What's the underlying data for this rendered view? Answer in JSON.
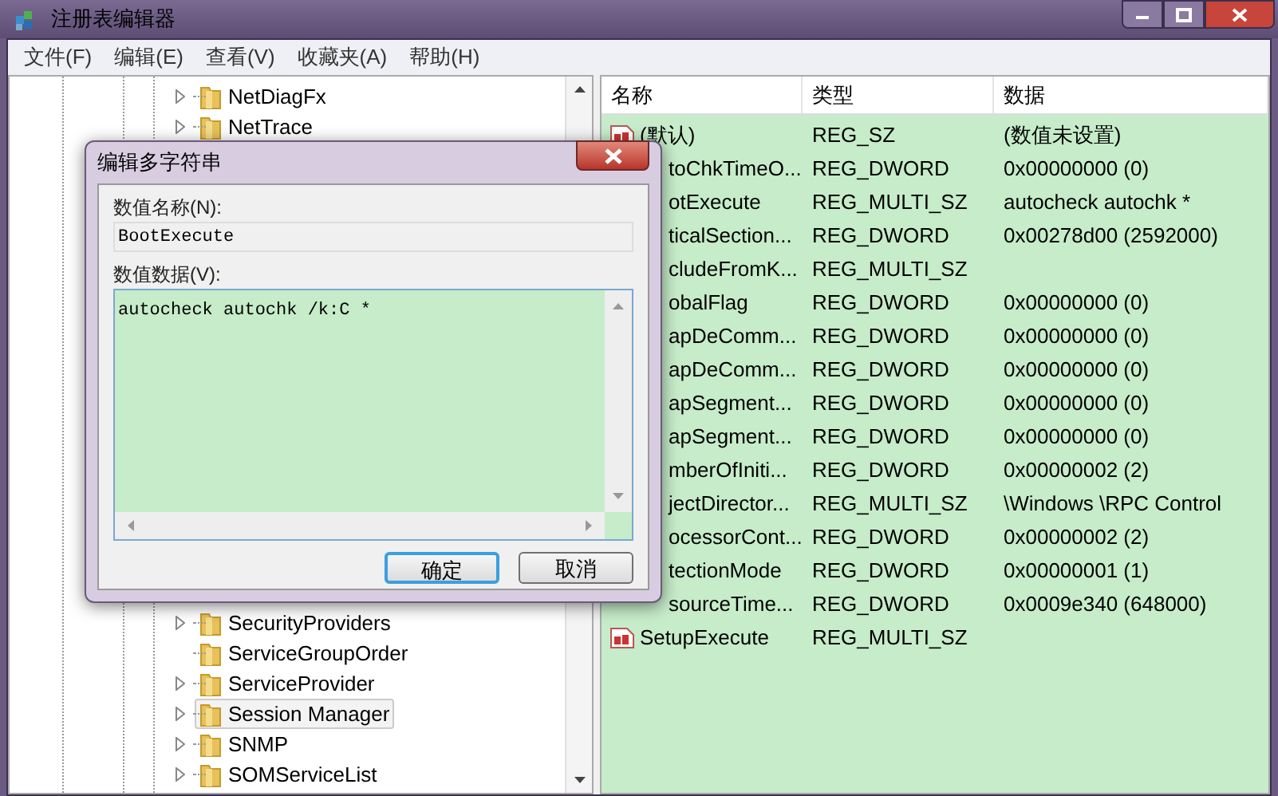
{
  "window": {
    "title": "注册表编辑器"
  },
  "menu": [
    "文件(F)",
    "编辑(E)",
    "查看(V)",
    "收藏夹(A)",
    "帮助(H)"
  ],
  "tree": [
    {
      "label": "NetDiagFx",
      "expandable": true,
      "selected": false
    },
    {
      "label": "NetTrace",
      "expandable": true,
      "selected": false
    }
  ],
  "tree_lower": [
    {
      "label": "SecurityProviders",
      "expandable": true,
      "selected": false
    },
    {
      "label": "ServiceGroupOrder",
      "expandable": false,
      "selected": false
    },
    {
      "label": "ServiceProvider",
      "expandable": true,
      "selected": false
    },
    {
      "label": "Session Manager",
      "expandable": true,
      "selected": true
    },
    {
      "label": "SNMP",
      "expandable": true,
      "selected": false
    },
    {
      "label": "SOMServiceList",
      "expandable": true,
      "selected": false
    }
  ],
  "list": {
    "columns": [
      "名称",
      "类型",
      "数据"
    ],
    "rows": [
      {
        "name": "(默认)",
        "type": "REG_SZ",
        "data": "(数值未设置)",
        "icon_visible": true
      },
      {
        "name": "toChkTimeO...",
        "type": "REG_DWORD",
        "data": "0x00000000 (0)",
        "icon_visible": false
      },
      {
        "name": "otExecute",
        "type": "REG_MULTI_SZ",
        "data": "autocheck autochk *",
        "icon_visible": false
      },
      {
        "name": "ticalSection...",
        "type": "REG_DWORD",
        "data": "0x00278d00 (2592000)",
        "icon_visible": false
      },
      {
        "name": "cludeFromK...",
        "type": "REG_MULTI_SZ",
        "data": "",
        "icon_visible": false
      },
      {
        "name": "obalFlag",
        "type": "REG_DWORD",
        "data": "0x00000000 (0)",
        "icon_visible": false
      },
      {
        "name": "apDeComm...",
        "type": "REG_DWORD",
        "data": "0x00000000 (0)",
        "icon_visible": false
      },
      {
        "name": "apDeComm...",
        "type": "REG_DWORD",
        "data": "0x00000000 (0)",
        "icon_visible": false
      },
      {
        "name": "apSegment...",
        "type": "REG_DWORD",
        "data": "0x00000000 (0)",
        "icon_visible": false
      },
      {
        "name": "apSegment...",
        "type": "REG_DWORD",
        "data": "0x00000000 (0)",
        "icon_visible": false
      },
      {
        "name": "mberOfIniti...",
        "type": "REG_DWORD",
        "data": "0x00000002 (2)",
        "icon_visible": false
      },
      {
        "name": "jectDirector...",
        "type": "REG_MULTI_SZ",
        "data": "\\Windows \\RPC Control",
        "icon_visible": false
      },
      {
        "name": "ocessorCont...",
        "type": "REG_DWORD",
        "data": "0x00000002 (2)",
        "icon_visible": false
      },
      {
        "name": "tectionMode",
        "type": "REG_DWORD",
        "data": "0x00000001 (1)",
        "icon_visible": false
      },
      {
        "name": "sourceTime...",
        "type": "REG_DWORD",
        "data": "0x0009e340 (648000)",
        "icon_visible": false
      },
      {
        "name": "SetupExecute",
        "type": "REG_MULTI_SZ",
        "data": "",
        "icon_visible": true
      }
    ]
  },
  "dialog": {
    "title": "编辑多字符串",
    "name_label": "数值名称(N):",
    "name_value": "BootExecute",
    "data_label": "数值数据(V):",
    "data_value": "autocheck autochk /k:C *",
    "buttons": [
      {
        "label": "确定",
        "default": true
      },
      {
        "label": "取消",
        "default": false
      }
    ]
  }
}
